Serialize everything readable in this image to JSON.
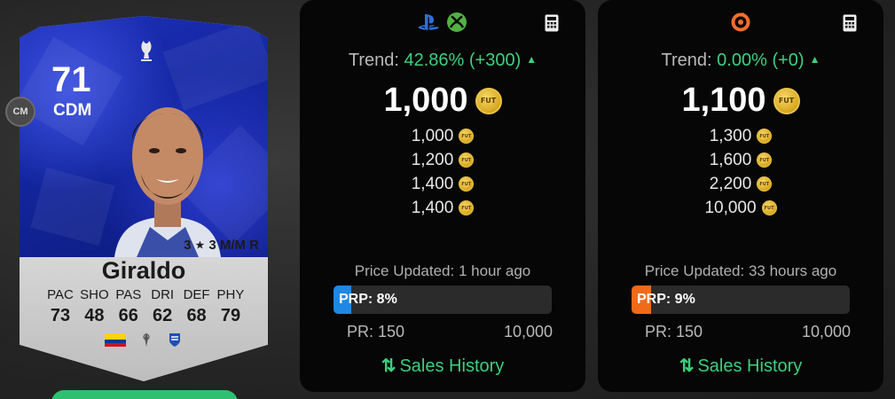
{
  "player": {
    "rating": "71",
    "position": "CDM",
    "alt_position": "CM",
    "skills_weak": "3",
    "skills_rest": "3 M/M R",
    "name": "Giraldo",
    "stat_labels": [
      "PAC",
      "SHO",
      "PAS",
      "DRI",
      "DEF",
      "PHY"
    ],
    "stat_values": [
      "73",
      "48",
      "66",
      "62",
      "68",
      "79"
    ],
    "icons": [
      "world-cup-logo-icon",
      "colombia-flag-icon",
      "league-logo-icon",
      "club-crest-icon"
    ]
  },
  "panels": {
    "console": {
      "platform_icons": [
        "playstation-icon",
        "xbox-icon"
      ],
      "trend_label": "Trend:",
      "trend_value": "42.86% (+300)",
      "main_price": "1,000",
      "prices": [
        "1,000",
        "1,200",
        "1,400",
        "1,400"
      ],
      "updated": "Price Updated: 1 hour ago",
      "prp_label": "PRP: 8%",
      "prp_percent": 8,
      "prp_color": "#1e88e5",
      "pr_min": "PR: 150",
      "pr_max": "10,000",
      "sales_label": "Sales History"
    },
    "pc": {
      "platform_icons": [
        "origin-icon"
      ],
      "trend_label": "Trend:",
      "trend_value": "0.00% (+0)",
      "main_price": "1,100",
      "prices": [
        "1,300",
        "1,600",
        "2,200",
        "10,000"
      ],
      "updated": "Price Updated: 33 hours ago",
      "prp_label": "PRP: 9%",
      "prp_percent": 9,
      "prp_color": "#f06a1a",
      "pr_min": "PR: 150",
      "pr_max": "10,000",
      "sales_label": "Sales History"
    }
  },
  "colors": {
    "accent_green": "#3ecf7f",
    "card_blue": "#1326a0",
    "coin_gold": "#d8a71f"
  }
}
